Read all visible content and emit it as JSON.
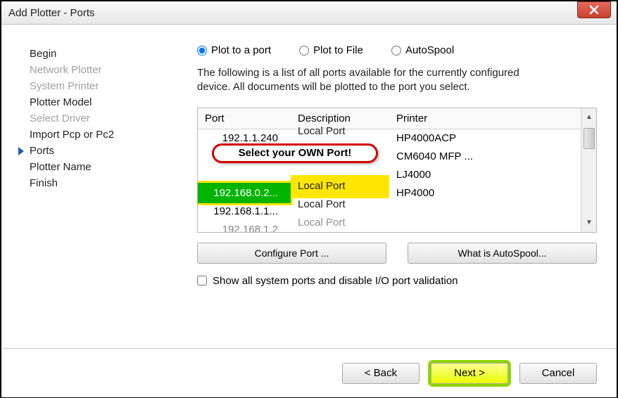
{
  "window": {
    "title": "Add Plotter - Ports"
  },
  "sidebar": {
    "steps": [
      {
        "label": "Begin",
        "disabled": false
      },
      {
        "label": "Network Plotter",
        "disabled": true
      },
      {
        "label": "System Printer",
        "disabled": true
      },
      {
        "label": "Plotter Model",
        "disabled": false
      },
      {
        "label": "Select Driver",
        "disabled": true
      },
      {
        "label": "Import Pcp or Pc2",
        "disabled": false
      },
      {
        "label": "Ports",
        "disabled": false,
        "current": true
      },
      {
        "label": "Plotter Name",
        "disabled": false
      },
      {
        "label": "Finish",
        "disabled": false
      }
    ]
  },
  "radios": {
    "plot_to_port": "Plot to a port",
    "plot_to_file": "Plot to File",
    "autospool": "AutoSpool",
    "selected": "plot_to_port"
  },
  "description": "The following is a list of all ports available for the currently configured device. All documents will be plotted to the port you select.",
  "table": {
    "headers": {
      "port": "Port",
      "description": "Description",
      "printer": "Printer"
    },
    "rows": [
      {
        "port": "192.1.1.240",
        "desc": "Local Port",
        "printer": "HP4000ACP"
      },
      {
        "port": "",
        "desc": "",
        "printer": "CM6040 MFP ..."
      },
      {
        "port": "",
        "desc": "",
        "printer": "LJ4000"
      },
      {
        "port": "192.168.0.2...",
        "desc": "Local Port",
        "printer": "HP4000",
        "selected": true
      },
      {
        "port": "192.168.1.1...",
        "desc": "Local Port",
        "printer": ""
      },
      {
        "port": "192.168.1.2",
        "desc": "Local Port",
        "printer": ""
      }
    ]
  },
  "annotation": "Select your OWN Port!",
  "buttons": {
    "configure_port": "Configure Port ...",
    "what_autospool": "What is AutoSpool...",
    "back": "< Back",
    "next": "Next >",
    "cancel": "Cancel"
  },
  "checkbox": {
    "label": "Show all system ports and disable I/O port validation"
  }
}
